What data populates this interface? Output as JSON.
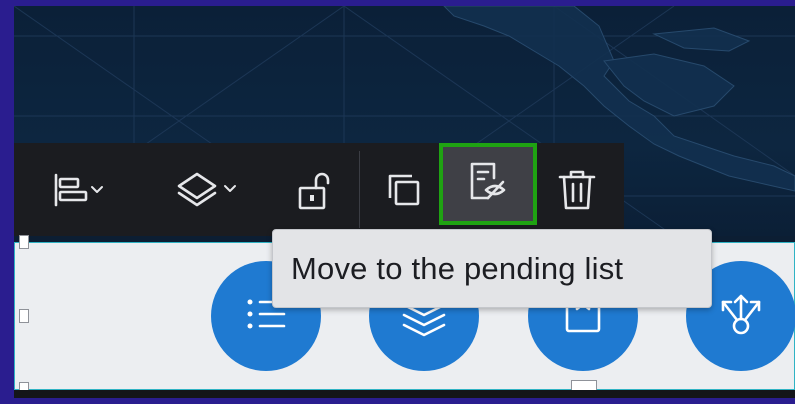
{
  "toolbar": {
    "buttons": [
      {
        "id": "align",
        "icon": "align-left-icon",
        "has_dropdown": true
      },
      {
        "id": "layers",
        "icon": "layers-icon",
        "has_dropdown": true
      },
      {
        "id": "unlock",
        "icon": "unlock-icon",
        "has_dropdown": false
      },
      {
        "id": "duplicate",
        "icon": "duplicate-icon",
        "has_dropdown": false
      },
      {
        "id": "move-to-pending",
        "icon": "pending-list-icon",
        "has_dropdown": false,
        "highlighted": true
      },
      {
        "id": "delete",
        "icon": "trash-icon",
        "has_dropdown": false
      }
    ]
  },
  "tooltip": {
    "text": "Move to the pending list"
  },
  "widget_buttons": [
    {
      "icon": "list-icon"
    },
    {
      "icon": "stack-layers-icon"
    },
    {
      "icon": "bookmark-icon"
    },
    {
      "icon": "share-arrows-icon"
    }
  ],
  "colors": {
    "outer_background": "#2a1d8f",
    "map_background": "#0b2038",
    "toolbar_background": "#1b1c20",
    "highlight_border": "#1fa312",
    "widget_blue": "#1f7ad1",
    "panel_background": "#eceef1",
    "selection_border": "#2fb3c4"
  }
}
